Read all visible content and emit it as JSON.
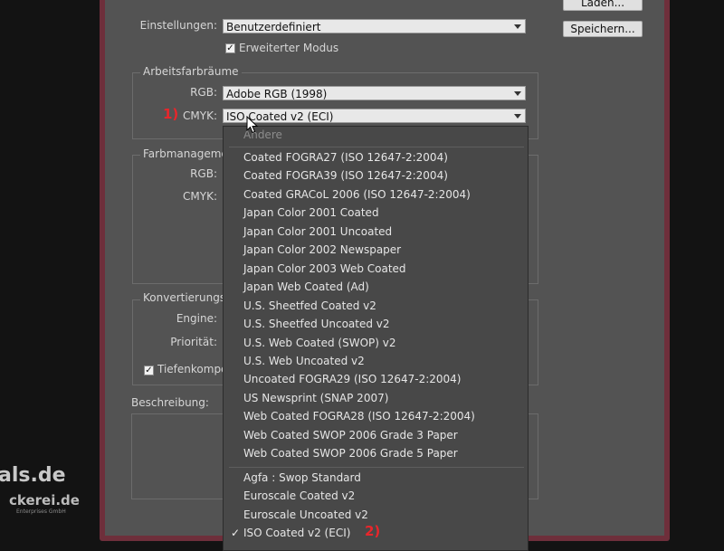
{
  "settings": {
    "label": "Einstellungen:",
    "value": "Benutzerdefiniert",
    "extended_mode": "Erweiterter Modus",
    "extended_checked": true
  },
  "buttons": {
    "load": "Laden...",
    "save": "Speichern..."
  },
  "workspaces": {
    "title": "Arbeitsfarbräume",
    "rgb_label": "RGB:",
    "rgb_value": "Adobe RGB (1998)",
    "cmyk_label": "CMYK:",
    "cmyk_value": "ISO Coated v2 (ECI)",
    "annotation": "1)"
  },
  "color_management": {
    "title": "Farbmanageme",
    "rgb_label": "RGB:",
    "cmyk_label": "CMYK:"
  },
  "conversion": {
    "title": "Konvertierungso",
    "engine_label": "Engine:",
    "priority_label": "Priorität:",
    "depth_label": "Tiefenkompe",
    "depth_checked": true
  },
  "description": {
    "label": "Beschreibung:"
  },
  "dropdown": {
    "other": "Andere",
    "items": [
      "Coated FOGRA27 (ISO 12647-2:2004)",
      "Coated FOGRA39 (ISO 12647-2:2004)",
      "Coated GRACoL 2006 (ISO 12647-2:2004)",
      "Japan Color 2001 Coated",
      "Japan Color 2001 Uncoated",
      "Japan Color 2002 Newspaper",
      "Japan Color 2003 Web Coated",
      "Japan Web Coated (Ad)",
      "U.S. Sheetfed Coated v2",
      "U.S. Sheetfed Uncoated v2",
      "U.S. Web Coated (SWOP) v2",
      "U.S. Web Uncoated v2",
      "Uncoated FOGRA29 (ISO 12647-2:2004)",
      "US Newsprint (SNAP 2007)",
      "Web Coated FOGRA28 (ISO 12647-2:2004)",
      "Web Coated SWOP 2006 Grade 3 Paper",
      "Web Coated SWOP 2006 Grade 5 Paper"
    ],
    "custom_items": [
      "Agfa : Swop Standard",
      "Euroscale Coated v2",
      "Euroscale Uncoated v2"
    ],
    "selected": "ISO Coated v2 (ECI)",
    "selected_annotation": "2)"
  },
  "watermark": {
    "line1": "als.de",
    "line2": "ckerei.de",
    "line3": "Enterprises GmbH"
  }
}
